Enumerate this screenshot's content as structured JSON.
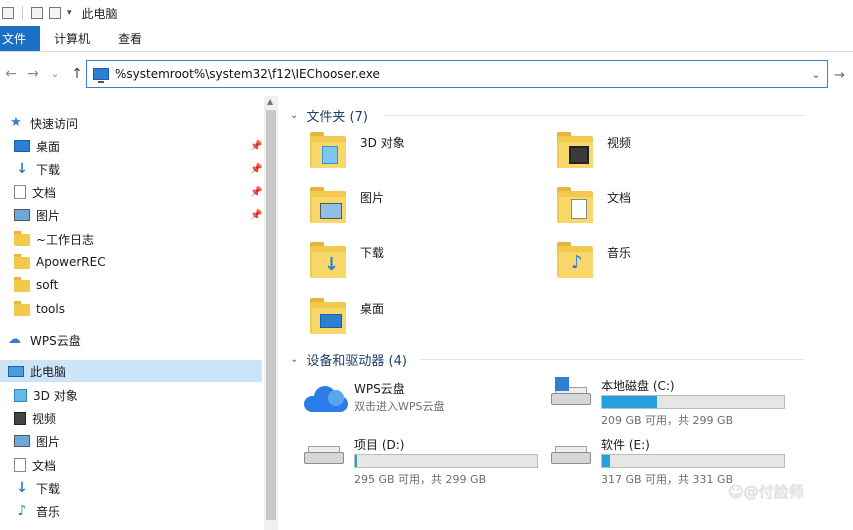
{
  "window": {
    "title": "此电脑"
  },
  "ribbon": {
    "tabs": [
      "文件",
      "计算机",
      "查看"
    ]
  },
  "address": {
    "path": "%systemroot%\\system32\\f12\\IEChooser.exe"
  },
  "nav": {
    "back": "←",
    "forward": "→",
    "dropdown": "⌄",
    "up": "↑",
    "go": "→"
  },
  "sidebar": {
    "items": [
      {
        "label": "快速访问",
        "icon": "star-icon"
      },
      {
        "label": "桌面",
        "icon": "desktop-icon",
        "pinned": true
      },
      {
        "label": "下载",
        "icon": "download-icon",
        "pinned": true
      },
      {
        "label": "文档",
        "icon": "document-icon",
        "pinned": true
      },
      {
        "label": "图片",
        "icon": "picture-icon",
        "pinned": true
      },
      {
        "label": "~工作日志",
        "icon": "folder-icon"
      },
      {
        "label": "ApowerREC",
        "icon": "folder-icon"
      },
      {
        "label": "soft",
        "icon": "folder-icon"
      },
      {
        "label": "tools",
        "icon": "folder-icon"
      },
      {
        "label": "WPS云盘",
        "icon": "cloud-icon"
      },
      {
        "label": "此电脑",
        "icon": "computer-icon",
        "selected": true
      },
      {
        "label": "3D 对象",
        "icon": "3d-objects-icon"
      },
      {
        "label": "视频",
        "icon": "video-icon"
      },
      {
        "label": "图片",
        "icon": "picture-icon"
      },
      {
        "label": "文档",
        "icon": "document-icon"
      },
      {
        "label": "下载",
        "icon": "download-icon"
      },
      {
        "label": "音乐",
        "icon": "music-icon"
      }
    ]
  },
  "folders_group": {
    "title": "文件夹 (7)",
    "items": [
      {
        "label": "3D 对象",
        "icon": "3d-objects-folder-icon"
      },
      {
        "label": "视频",
        "icon": "video-folder-icon"
      },
      {
        "label": "图片",
        "icon": "pictures-folder-icon"
      },
      {
        "label": "文档",
        "icon": "documents-folder-icon"
      },
      {
        "label": "下载",
        "icon": "downloads-folder-icon"
      },
      {
        "label": "音乐",
        "icon": "music-folder-icon"
      },
      {
        "label": "桌面",
        "icon": "desktop-folder-icon"
      }
    ]
  },
  "devices_group": {
    "title": "设备和驱动器 (4)",
    "wps": {
      "name": "WPS云盘",
      "subtitle": "双击进入WPS云盘"
    },
    "drives": [
      {
        "name": "本地磁盘 (C:)",
        "info": "209 GB 可用，共 299 GB",
        "used_fraction": 0.301
      },
      {
        "name": "项目 (D:)",
        "info": "295 GB 可用，共 299 GB",
        "used_fraction": 0.013
      },
      {
        "name": "软件 (E:)",
        "info": "317 GB 可用，共 331 GB",
        "used_fraction": 0.042
      }
    ]
  },
  "watermark": {
    "text": "☺@付脸师"
  },
  "colors": {
    "accent": "#1a6fc6",
    "selection": "#cce4f7",
    "drive_bar": "#26a0da"
  }
}
